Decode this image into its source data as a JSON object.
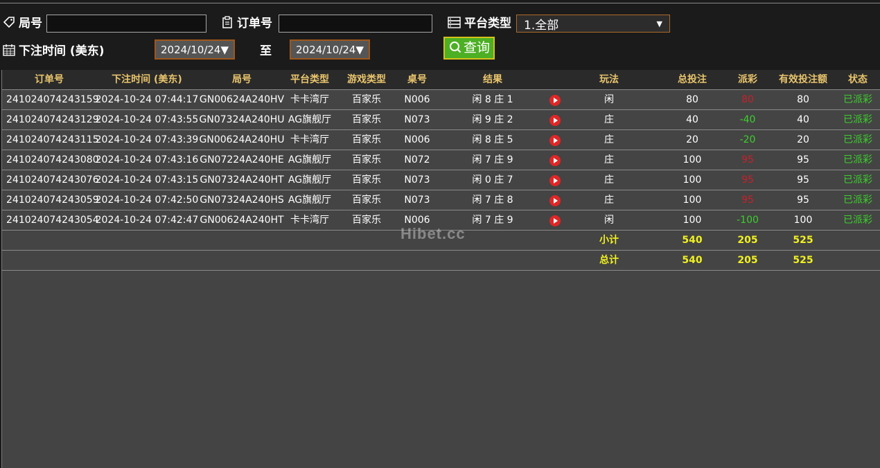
{
  "filters": {
    "round_label": "局号",
    "round_value": "",
    "order_label": "订单号",
    "order_value": "",
    "platform_label": "平台类型",
    "platform_selected": "1.全部",
    "time_label": "下注时间 (美东)",
    "date_from": "2024/10/24▼",
    "to_label": "至",
    "date_to": "2024/10/24▼",
    "query_label": "查询"
  },
  "table": {
    "headers": [
      "订单号",
      "下注时间 (美东)",
      "局号",
      "平台类型",
      "游戏类型",
      "桌号",
      "结果",
      "玩法",
      "总投注",
      "派彩",
      "有效投注额",
      "状态"
    ],
    "rows": [
      {
        "order": "241024074243159",
        "time": "2024-10-24 07:44:17",
        "round": "GN00624A240HV",
        "platform": "卡卡湾厅",
        "game": "百家乐",
        "table": "N006",
        "result": "闲 8 庄 1",
        "play": "闲",
        "bet": "80",
        "payout": "80",
        "payout_color": "#c8202a",
        "valid": "80",
        "status": "已派彩"
      },
      {
        "order": "241024074243129",
        "time": "2024-10-24 07:43:55",
        "round": "GN07324A240HU",
        "platform": "AG旗舰厅",
        "game": "百家乐",
        "table": "N073",
        "result": "闲 9 庄 2",
        "play": "庄",
        "bet": "40",
        "payout": "-40",
        "payout_color": "#3ccf2c",
        "valid": "40",
        "status": "已派彩"
      },
      {
        "order": "241024074243115",
        "time": "2024-10-24 07:43:39",
        "round": "GN00624A240HU",
        "platform": "卡卡湾厅",
        "game": "百家乐",
        "table": "N006",
        "result": "闲 8 庄 5",
        "play": "庄",
        "bet": "20",
        "payout": "-20",
        "payout_color": "#3ccf2c",
        "valid": "20",
        "status": "已派彩"
      },
      {
        "order": "241024074243080",
        "time": "2024-10-24 07:43:16",
        "round": "GN07224A240HE",
        "platform": "AG旗舰厅",
        "game": "百家乐",
        "table": "N072",
        "result": "闲 7 庄 9",
        "play": "庄",
        "bet": "100",
        "payout": "95",
        "payout_color": "#c8202a",
        "valid": "95",
        "status": "已派彩"
      },
      {
        "order": "241024074243076",
        "time": "2024-10-24 07:43:15",
        "round": "GN07324A240HT",
        "platform": "AG旗舰厅",
        "game": "百家乐",
        "table": "N073",
        "result": "闲 0 庄 7",
        "play": "庄",
        "bet": "100",
        "payout": "95",
        "payout_color": "#c8202a",
        "valid": "95",
        "status": "已派彩"
      },
      {
        "order": "241024074243059",
        "time": "2024-10-24 07:42:50",
        "round": "GN07324A240HS",
        "platform": "AG旗舰厅",
        "game": "百家乐",
        "table": "N073",
        "result": "闲 7 庄 8",
        "play": "庄",
        "bet": "100",
        "payout": "95",
        "payout_color": "#c8202a",
        "valid": "95",
        "status": "已派彩"
      },
      {
        "order": "241024074243054",
        "time": "2024-10-24 07:42:47",
        "round": "GN00624A240HT",
        "platform": "卡卡湾厅",
        "game": "百家乐",
        "table": "N006",
        "result": "闲 7 庄 9",
        "play": "闲",
        "bet": "100",
        "payout": "-100",
        "payout_color": "#3ccf2c",
        "valid": "100",
        "status": "已派彩"
      }
    ],
    "subtotal": {
      "label": "小计",
      "bet": "540",
      "payout": "205",
      "valid": "525"
    },
    "total": {
      "label": "总计",
      "bet": "540",
      "payout": "205",
      "valid": "525"
    }
  },
  "watermark": "Hibet.cc",
  "icons": {
    "round": "tag-icon",
    "order": "clipboard-icon",
    "platform": "server-icon",
    "time": "calendar-icon",
    "query": "search-icon",
    "replay": "play-icon"
  },
  "colors": {
    "header_text": "#e8c46c",
    "status_green": "#3ccf2c",
    "loss_red": "#c8202a",
    "sum_yellow": "#f0f020",
    "query_green": "#4caf24",
    "accent_orange": "#b06a2a"
  }
}
